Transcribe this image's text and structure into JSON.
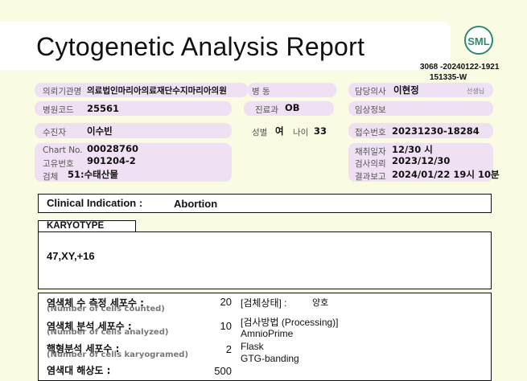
{
  "header": {
    "title": "Cytogenetic Analysis Report",
    "logo_text": "SML",
    "ref_line1": "3068 -20240122-1921",
    "ref_line2": "151335-W"
  },
  "info": {
    "institution_label": "의뢰기관명",
    "institution_value": "의료법인마리아의료재단수지마리아의원",
    "ward_label": "병 동",
    "doctor_label": "담당의사",
    "doctor_value": "이현정",
    "doctor_suffix": "선생님",
    "hospital_code_label": "병원코드",
    "hospital_code_value": "25561",
    "dept_label": "진료과",
    "dept_value": "OB",
    "clinical_info_label": "임상정보",
    "patient_label": "수진자",
    "patient_value": "이수빈",
    "sex_label": "성별",
    "sex_value": "여",
    "age_label": "나이",
    "age_value": "33",
    "receipt_label": "접수번호",
    "receipt_value": "20231230-18284",
    "chart_label": "Chart No.",
    "chart_value": "00028760",
    "unique_label": "고유번호",
    "unique_value": "901204-2",
    "specimen_label": "검체",
    "specimen_value": "51:수태산물",
    "collect_label": "채취일자",
    "collect_value": "12/30 시",
    "request_label": "검사의뢰",
    "request_value": "2023/12/30",
    "result_label": "결과보고",
    "result_value": "2024/01/22 19시 10분"
  },
  "clinical_indication": {
    "label": "Clinical Indication :",
    "value": "Abortion"
  },
  "karyotype": {
    "label": "KARYOTYPE",
    "value": "47,XY,+16"
  },
  "stats": {
    "counted_label": "염색체 수 측정 세포수 :",
    "counted_sub": "(Number of cells counted)",
    "counted_value": "20",
    "analyzed_label": "염색체 분석 세포수 :",
    "analyzed_sub": "(Number of cells analyzed)",
    "analyzed_value": "10",
    "karyogramed_label": "핵형분석 세포수 :",
    "karyogramed_sub": "(Number of cells karyogramed)",
    "karyogramed_value": "2",
    "resolution_label": "염색대 해상도 :",
    "resolution_value": "500",
    "specimen_state_label": "[검체상태] :",
    "specimen_state_value": "양호",
    "method_label": "[검사방법 (Processing)]",
    "method_line1": "AmnioPrime",
    "method_line2": "Flask",
    "method_line3": "GTG-banding"
  }
}
